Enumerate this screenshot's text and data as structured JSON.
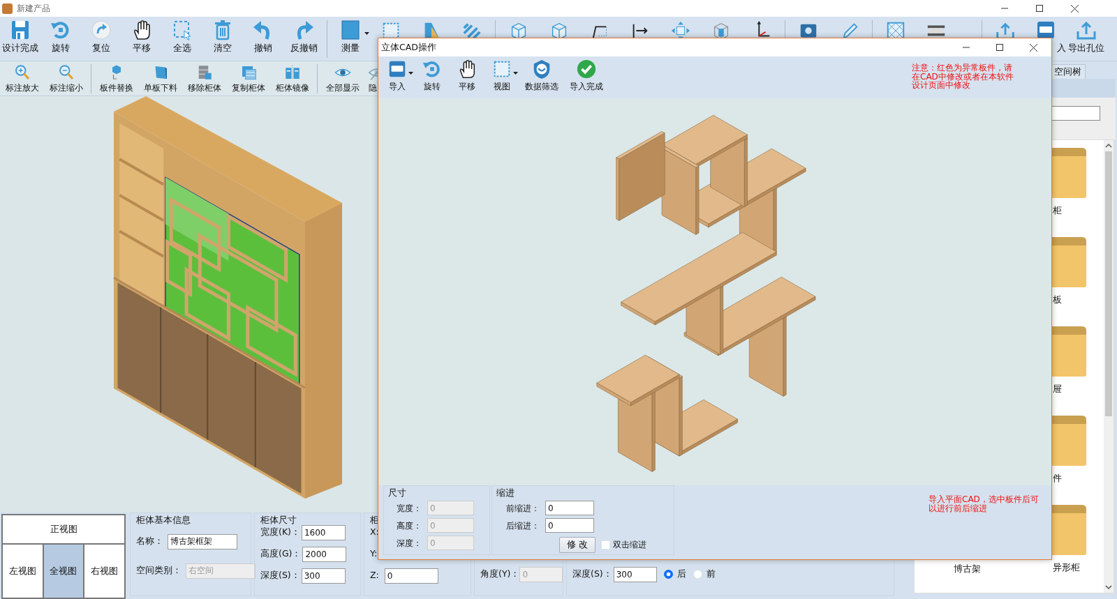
{
  "window": {
    "title": "新建产品"
  },
  "toolbar": [
    {
      "kind": "button",
      "label": "设计完成"
    },
    {
      "kind": "button",
      "label": "旋转"
    },
    {
      "kind": "button",
      "label": "复位"
    },
    {
      "kind": "button",
      "label": "平移"
    },
    {
      "kind": "button",
      "label": "全选"
    },
    {
      "kind": "button",
      "label": "清空"
    },
    {
      "kind": "button",
      "label": "撤销"
    },
    {
      "kind": "button",
      "label": "反撤销"
    },
    {
      "kind": "separator"
    },
    {
      "kind": "dropdown_button",
      "label": "测量"
    },
    {
      "kind": "icon_button"
    },
    {
      "kind": "icon_button"
    },
    {
      "kind": "icon_button"
    },
    {
      "kind": "separator"
    },
    {
      "kind": "icon_button"
    },
    {
      "kind": "icon_button"
    },
    {
      "kind": "icon_button"
    },
    {
      "kind": "icon_button"
    },
    {
      "kind": "icon_button"
    },
    {
      "kind": "icon_button"
    },
    {
      "kind": "icon_button"
    },
    {
      "kind": "separator"
    },
    {
      "kind": "icon_button"
    },
    {
      "kind": "icon_button"
    },
    {
      "kind": "separator"
    },
    {
      "kind": "icon_button"
    },
    {
      "kind": "icon_button"
    },
    {
      "kind": "separator"
    },
    {
      "kind": "icon_button"
    },
    {
      "kind": "button",
      "label": "入"
    },
    {
      "kind": "button",
      "label": "导出孔位"
    }
  ],
  "toolbar2": [
    {
      "kind": "button",
      "label": "标注放大"
    },
    {
      "kind": "button",
      "label": "标注缩小"
    },
    {
      "kind": "separator"
    },
    {
      "kind": "button",
      "label": "板件替换"
    },
    {
      "kind": "button",
      "label": "单板下料"
    },
    {
      "kind": "button",
      "label": "移除柜体"
    },
    {
      "kind": "button",
      "label": "复制柜体"
    },
    {
      "kind": "button",
      "label": "柜体镜像"
    },
    {
      "kind": "separator"
    },
    {
      "kind": "button",
      "label": "全部显示"
    },
    {
      "kind": "button",
      "label": "隐"
    }
  ],
  "view_buttons": [
    {
      "label": "正视图",
      "selected": false
    },
    {
      "label": "左视图",
      "selected": false
    },
    {
      "label": "全视图",
      "selected": true
    },
    {
      "label": "右视图",
      "selected": false
    }
  ],
  "basic_info": {
    "title": "柜体基本信息",
    "fields": [
      {
        "label": "名称：",
        "value": "博古架框架",
        "disabled": false
      },
      {
        "label": "空间类别：",
        "value": "右空间",
        "disabled": true
      }
    ]
  },
  "dimensions": {
    "title": "柜体尺寸",
    "fields": [
      {
        "label": "宽度(K)：",
        "value": "1600",
        "disabled": false
      },
      {
        "label": "高度(G)：",
        "value": "2000",
        "disabled": false
      },
      {
        "label": "深度(S)：",
        "value": "300",
        "disabled": false
      }
    ]
  },
  "position": {
    "title": "柜",
    "fields": [
      {
        "label": "X:"
      },
      {
        "label": "Y:"
      },
      {
        "label": "Z:",
        "value": "0",
        "disabled": false
      }
    ]
  },
  "rotation": {
    "fields": [
      {
        "label": "角度(Y)：",
        "value": "0",
        "disabled": true
      }
    ]
  },
  "depth_side": {
    "label": "深度(S)：",
    "value": "300",
    "options": [
      {
        "label": "后",
        "selected": true
      },
      {
        "label": "前",
        "selected": false
      }
    ]
  },
  "library": {
    "tab": "空间树",
    "folder_rows": [
      {
        "right_label": "柜"
      },
      {
        "right_label": "板"
      },
      {
        "right_label": "屉"
      },
      {
        "right_label": "件"
      },
      {
        "left_label": "博古架",
        "right_label": "异形柜"
      }
    ]
  },
  "dialog": {
    "title": "立体CAD操作",
    "toolbar": [
      {
        "kind": "dropdown_button",
        "label": "导入"
      },
      {
        "kind": "button",
        "label": "旋转"
      },
      {
        "kind": "button",
        "label": "平移"
      },
      {
        "kind": "dropdown_button",
        "label": "视图"
      },
      {
        "kind": "button",
        "label": "数据筛选"
      },
      {
        "kind": "button",
        "label": "导入完成"
      }
    ],
    "notice": "注意：红色为异常板件，请在CAD中修改或者在本软件设计页面中修改",
    "size_group": {
      "title": "尺寸",
      "fields": [
        {
          "label": "宽度：",
          "value": "0",
          "disabled": true
        },
        {
          "label": "高度：",
          "value": "0",
          "disabled": true
        },
        {
          "label": "深度：",
          "value": "0",
          "disabled": true
        }
      ]
    },
    "indent_group": {
      "title": "缩进",
      "fields": [
        {
          "label": "前缩进：",
          "value": "0",
          "disabled": false
        },
        {
          "label": "后缩进：",
          "value": "0",
          "disabled": false
        }
      ],
      "apply_button": "修 改",
      "checkbox": {
        "label": "双击缩进",
        "checked": false
      }
    },
    "hint": "导入平面CAD，选中板件后可以进行前后缩进"
  }
}
